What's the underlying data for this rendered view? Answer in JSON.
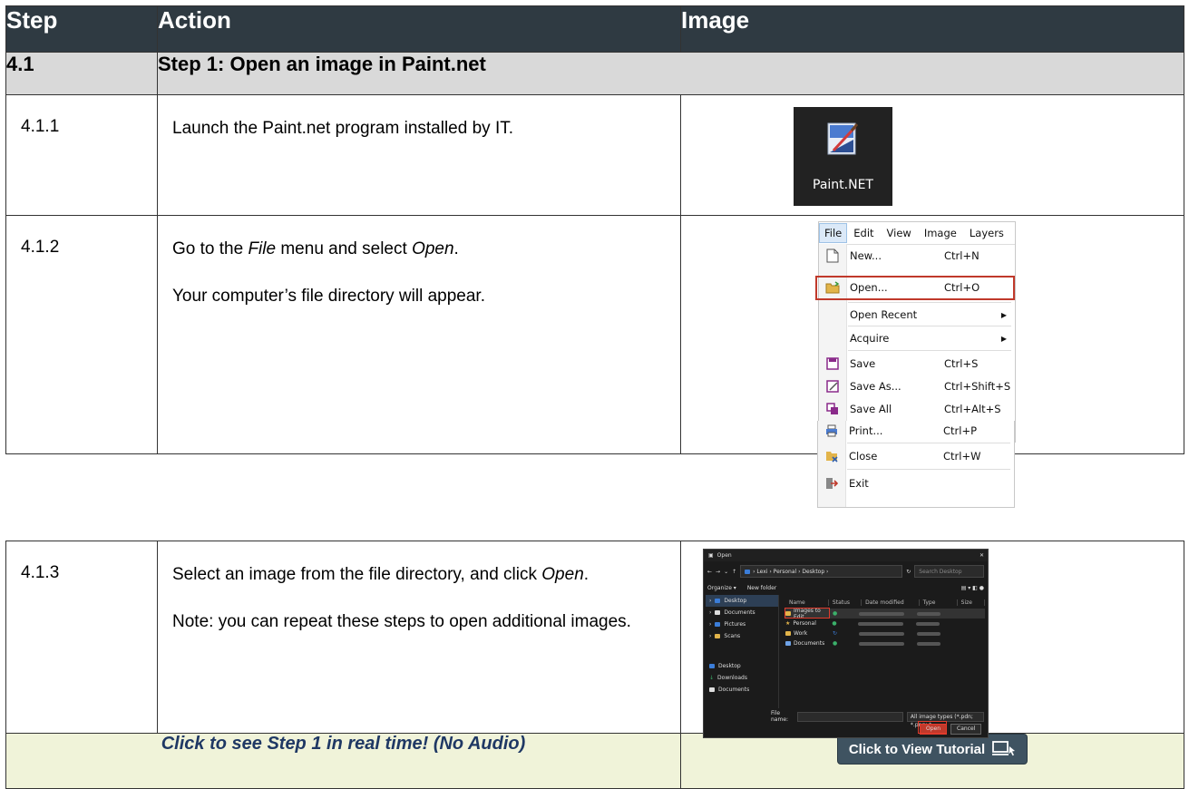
{
  "header": {
    "col_step": "Step",
    "col_action": "Action",
    "col_image": "Image"
  },
  "section": {
    "number": "4.1",
    "title": "Step 1: Open an image in Paint.net"
  },
  "rows": [
    {
      "step": "4.1.1",
      "action": [
        "Launch the Paint.net program installed by IT."
      ]
    },
    {
      "step": "4.1.2",
      "action_parts": {
        "pre": "Go to the ",
        "em1": "File",
        "mid": " menu and select ",
        "em2": "Open",
        "post": "."
      },
      "action2": "Your computer’s file directory will appear."
    },
    {
      "step": "4.1.3",
      "action_parts": {
        "pre": "Select an image from the file directory, and click ",
        "em": "Open",
        "post": "."
      },
      "action2": "Note: you can repeat these steps to open additional images."
    }
  ],
  "paintnet_icon": {
    "label": "Paint.NET"
  },
  "file_menu": {
    "bar": [
      "File",
      "Edit",
      "View",
      "Image",
      "Layers"
    ],
    "items": [
      {
        "label": "New...",
        "shortcut": "Ctrl+N",
        "icon": "new-file-icon"
      },
      {
        "label": "Open...",
        "shortcut": "Ctrl+O",
        "icon": "open-folder-icon"
      },
      {
        "label": "Open Recent",
        "shortcut": "",
        "icon": ""
      },
      {
        "label": "Acquire",
        "shortcut": "",
        "icon": ""
      },
      {
        "label": "Save",
        "shortcut": "Ctrl+S",
        "icon": "save-icon"
      },
      {
        "label": "Save As...",
        "shortcut": "Ctrl+Shift+S",
        "icon": "save-as-icon"
      },
      {
        "label": "Save All",
        "shortcut": "Ctrl+Alt+S",
        "icon": "save-all-icon"
      },
      {
        "label": "Print...",
        "shortcut": "Ctrl+P",
        "icon": "print-icon"
      },
      {
        "label": "Close",
        "shortcut": "Ctrl+W",
        "icon": "close-icon"
      },
      {
        "label": "Exit",
        "shortcut": "",
        "icon": "exit-icon"
      }
    ]
  },
  "open_dialog": {
    "title": "Open",
    "path": "› Lexi › Personal › Desktop ›",
    "search": "Search Desktop",
    "organize": "Organize ▾",
    "new_folder": "New folder",
    "nav": [
      "Desktop",
      "Documents",
      "Pictures",
      "Scans",
      "Desktop",
      "Downloads",
      "Documents"
    ],
    "columns": [
      "Name",
      "Status",
      "Date modified",
      "Type",
      "Size"
    ],
    "files": [
      "Images to Edit",
      "Personal",
      "Work",
      "Documents"
    ],
    "file_name_label": "File name:",
    "file_types": "All image types (*.pdn; *.png; *",
    "open_btn": "Open",
    "cancel_btn": "Cancel"
  },
  "footer": {
    "caption": "Click to see Step 1 in real time! (No Audio)",
    "button": "Click to View Tutorial"
  },
  "colors": {
    "header_bg": "#2f3a42",
    "section_bg": "#d9d9d9",
    "footer_bg": "#f0f3d9",
    "highlight": "#c0392b"
  }
}
